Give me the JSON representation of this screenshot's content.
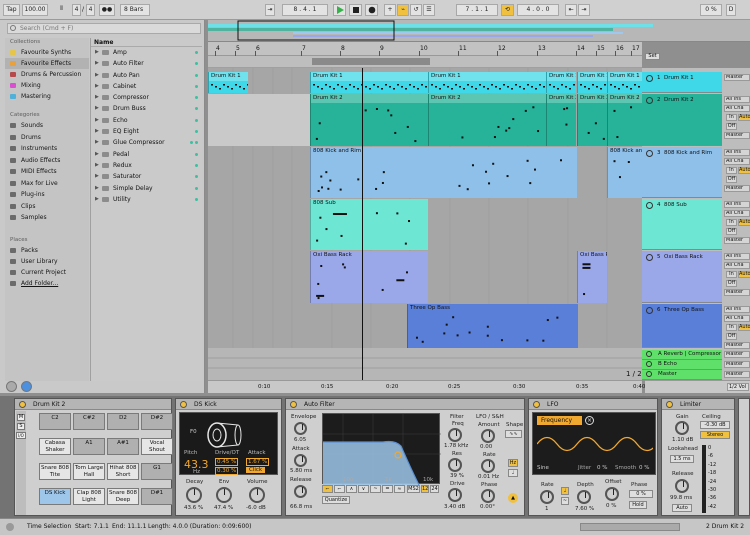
{
  "transport": {
    "tap": "Tap",
    "tempo": "100.00",
    "sig_num": "4",
    "sig_den": "4",
    "metro": "●●",
    "quant": "8 Bars",
    "position": "8 . 4 . 1",
    "loop_start": "7 . 1 . 1",
    "loop_len": "4 . 0 . 0",
    "cpu": "0 %",
    "d": "D"
  },
  "browser": {
    "search_placeholder": "Search (Cmd + F)",
    "collections_title": "Collections",
    "collections": [
      "Favourite Synths",
      "Favourite Effects",
      "Drums & Percussion",
      "Mixing",
      "Mastering"
    ],
    "collection_colors": [
      "#e6c64a",
      "#e8a13c",
      "#b64a4a",
      "#d94fd0",
      "#4fb0d9"
    ],
    "categories_title": "Categories",
    "categories": [
      "Sounds",
      "Drums",
      "Instruments",
      "Audio Effects",
      "MIDI Effects",
      "Max for Live",
      "Plug-ins",
      "Clips",
      "Samples"
    ],
    "places_title": "Places",
    "places": [
      "Packs",
      "User Library",
      "Current Project",
      "Add Folder..."
    ],
    "name_header": "Name",
    "items": [
      "Amp",
      "Auto Filter",
      "Auto Pan",
      "Cabinet",
      "Compressor",
      "Drum Buss",
      "Echo",
      "EQ Eight",
      "Glue Compressor",
      "Pedal",
      "Redux",
      "Saturator",
      "Simple Delay",
      "Utility"
    ]
  },
  "ruler": {
    "bars": [
      "4",
      "5",
      "6",
      "7",
      "8",
      "9",
      "10",
      "11",
      "12",
      "13",
      "14",
      "15",
      "16",
      "17"
    ],
    "set_label": "Set"
  },
  "tracks": [
    {
      "num": "1",
      "name": "Drum Kit 1",
      "color": "#3fd8e8",
      "input": "Master",
      "clips": [
        {
          "name": "Drum Kit 1"
        },
        {
          "name": "Drum Kit 1"
        },
        {
          "name": "Drum Kit 1"
        },
        {
          "name": "Drum Kit 1"
        },
        {
          "name": "Drum Kit 1"
        },
        {
          "name": "Drum Kit 1"
        }
      ]
    },
    {
      "num": "2",
      "name": "Drum Kit 2",
      "color": "#26b39a",
      "input": "All Ins",
      "chan": "All Cha",
      "clips": [
        {
          "name": "Drum Kit 2"
        },
        {
          "name": "Drum Kit 2"
        },
        {
          "name": "Drum Kit 2"
        },
        {
          "name": "Drum Kit 2"
        },
        {
          "name": "Drum Kit 2"
        }
      ]
    },
    {
      "num": "3",
      "name": "808 Kick and Rim",
      "color": "#8ec0ea",
      "input": "All Ins",
      "clips": [
        {
          "name": "808 Kick and Rim"
        },
        {
          "name": "808 Kick and"
        }
      ]
    },
    {
      "num": "4",
      "name": "808 Sub",
      "color": "#6ee6d4",
      "input": "All Ins",
      "clips": [
        {
          "name": "808 Sub"
        }
      ]
    },
    {
      "num": "5",
      "name": "Oxi Bass Rack",
      "color": "#9aa8ea",
      "input": "All Ins",
      "clips": [
        {
          "name": "Oxi Bass Rack"
        },
        {
          "name": "Oxi Bass R"
        }
      ]
    },
    {
      "num": "6",
      "name": "Three Op Bass",
      "color": "#5a7fd8",
      "input": "All Ins",
      "clips": [
        {
          "name": "Three Op Bass"
        }
      ]
    }
  ],
  "returns": [
    {
      "name": "A Reverb | Compressor",
      "color": "#5fe06a"
    },
    {
      "name": "B Echo",
      "color": "#5fe06a"
    },
    {
      "name": "Master",
      "color": "#5fe06a"
    }
  ],
  "io_labels": {
    "in": "In",
    "auto": "Auto",
    "off": "Off",
    "master": "Master",
    "all_ins": "All Ins",
    "all_cha": "All Cha"
  },
  "timeline": {
    "marks": [
      "0:10",
      "0:15",
      "0:20",
      "0:25",
      "0:30",
      "0:35",
      "0:40"
    ],
    "page": "1 / 2",
    "master_io": "1/2 Vol"
  },
  "devices": {
    "drumrack": {
      "title": "Drum Kit 2",
      "pads": [
        "C2",
        "C#2",
        "D2",
        "D#2",
        "Cabasa Shaker Mid",
        "A1",
        "A#1",
        "Vocal Shout Wha",
        "Snare 808 Tite",
        "Tom Large Hall",
        "Hihat 808 Short",
        "G1",
        "DS Kick",
        "Clap 808 Light",
        "Snare 808 Deep",
        "D#1"
      ],
      "left_labels": [
        "M",
        "S",
        "I/O"
      ]
    },
    "dskick": {
      "title": "DS Kick",
      "pitch_label": "Pitch",
      "pitch": "43.3",
      "pitch_unit": "Hz",
      "drive_label": "Drive/OT",
      "drive1": "0.45 %",
      "drive2": "0.30 %",
      "attack_label": "Attack",
      "attack": "1.67 %",
      "click": "Click",
      "decay_label": "Decay",
      "decay": "43.6 %",
      "env_label": "Env",
      "env": "47.4 %",
      "volume_label": "Volume",
      "volume": "-6.0 dB",
      "f0": "F0"
    },
    "autofilter": {
      "title": "Auto Filter",
      "envelope": "Envelope",
      "env_val": "6.05",
      "attack_label": "Attack",
      "attack": "5.80 ms",
      "release_label": "Release",
      "release": "66.8 ms",
      "quantize": "Quantize",
      "ms2": "MS2",
      "n12": "12",
      "n24": "24",
      "freq_ticks": [
        "100",
        "1k",
        "10k"
      ],
      "filter": "Filter",
      "freq_label": "Freq",
      "freq": "1.78 kHz",
      "res_label": "Res",
      "res": "39 %",
      "drive_label": "Drive",
      "drive": "3.40 dB",
      "lfo": "LFO / S&H",
      "amount_label": "Amount",
      "amount": "0.00",
      "rate_label": "Rate",
      "rate": "0.01 Hz",
      "phase_label": "Phase",
      "phase": "0.00°",
      "shape_label": "Shape",
      "hz": "Hz",
      "tri": "▲"
    },
    "lfo": {
      "title": "LFO",
      "frequency": "Frequency",
      "sine": "Sine",
      "jitter_label": "Jitter",
      "jitter": "0 %",
      "smooth_label": "Smooth",
      "smooth": "0 %",
      "rate_label": "Rate",
      "rate": "1",
      "depth_label": "Depth",
      "depth": "7.60 %",
      "offset_label": "Offset",
      "offset": "0 %",
      "phase_label": "Phase",
      "phase": "0 %",
      "hold": "Hold"
    },
    "limiter": {
      "title": "Limiter",
      "gain_label": "Gain",
      "gain": "1.10 dB",
      "ceiling_label": "Ceiling",
      "ceiling": "-0.30 dB",
      "stereo": "Stereo",
      "lookahead_label": "Lookahead",
      "lookahead": "1.5 ms",
      "release_label": "Release",
      "release": "99.8 ms",
      "auto": "Auto",
      "meter_ticks": [
        "0",
        "-6",
        "-12",
        "-18",
        "-24",
        "-30",
        "-36",
        "-42"
      ]
    }
  },
  "status": {
    "label": "Time Selection",
    "start": "Start: 7.1.1",
    "end": "End: 11.1.1",
    "length": "Length: 4.0.0 (Duration: 0:09:600)",
    "track": "2 Drum Kit 2"
  }
}
